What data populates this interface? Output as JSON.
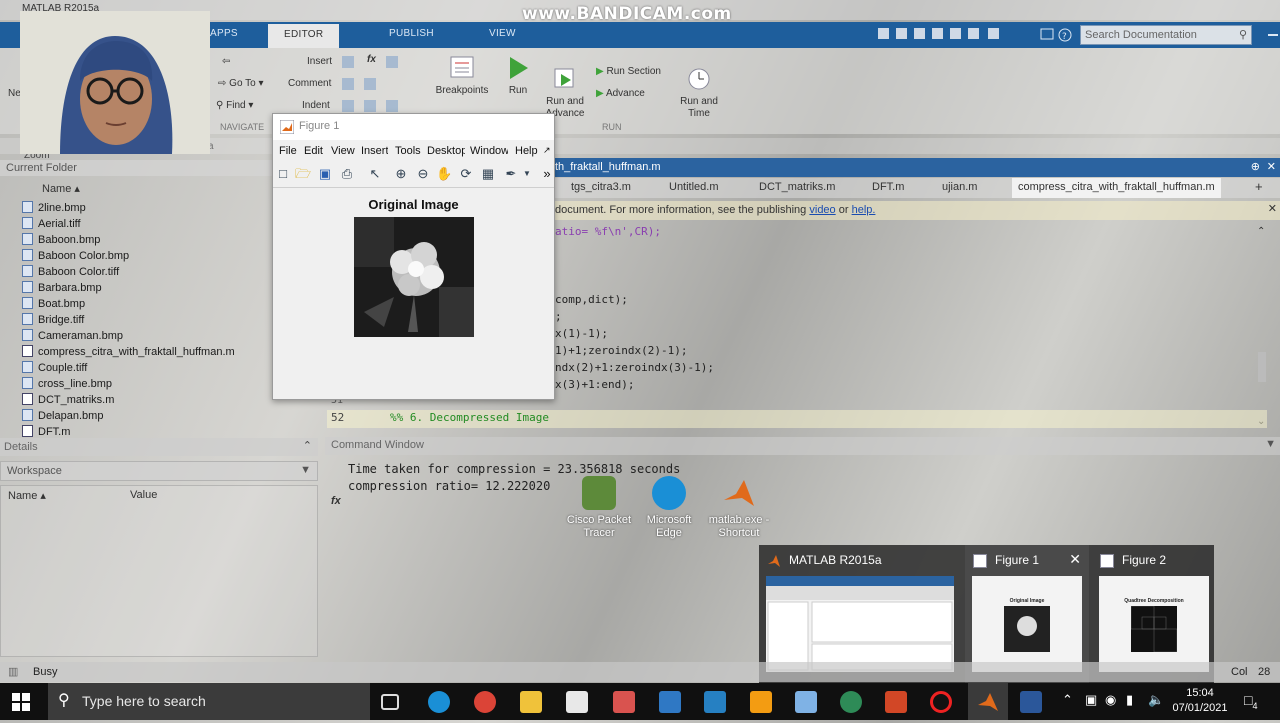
{
  "window": {
    "title": "MATLAB R2015a"
  },
  "watermark": "www.BANDICAM.com",
  "ribbon": {
    "tabs": [
      "APPS",
      "EDITOR",
      "PUBLISH",
      "VIEW"
    ],
    "search_placeholder": "Search Documentation",
    "goto_label": "Go To ▾",
    "find_label": "Find ▾",
    "insert_label": "Insert",
    "comment_label": "Comment",
    "indent_label": "Indent",
    "fx_label": "fx",
    "navigate_section": "NAVIGATE",
    "run_section": "RUN",
    "breakpoints_label": "Breakpoints",
    "run_label": "Run",
    "run_advance_label": "Run and\nAdvance",
    "run_section_label": "Run Section",
    "advance_label": "Advance",
    "run_time_label": "Run and\nTime",
    "ne_fragment": "Ne",
    "a_fragment": "a",
    "zoom_label": "Zoom"
  },
  "current_folder": {
    "title": "Current Folder",
    "column": "Name ▴",
    "files": [
      "2line.bmp",
      "Aerial.tiff",
      "Baboon.bmp",
      "Baboon Color.bmp",
      "Baboon Color.tiff",
      "Barbara.bmp",
      "Boat.bmp",
      "Bridge.tiff",
      "Cameraman.bmp",
      "compress_citra_with_fraktall_huffman.m",
      "Couple.tiff",
      "cross_line.bmp",
      "DCT_matriks.m",
      "Delapan.bmp",
      "DFT.m"
    ]
  },
  "details": {
    "title": "Details"
  },
  "workspace": {
    "title": "Workspace",
    "col_name": "Name ▴",
    "col_value": "Value"
  },
  "editor": {
    "title_fragment": "th_fraktall_huffman.m",
    "tabs": [
      "tgs_citra3.m",
      "Untitled.m",
      "DCT_matriks.m",
      "DFT.m",
      "ujian.m",
      "compress_citra_with_fraktall_huffman.m",
      "+"
    ],
    "info_text": "document. For more information, see the publishing",
    "info_link1": "video",
    "info_or": "or",
    "info_link2": "help.",
    "code_lines": [
      "atio= %f\\n',CR);",
      "comp,dict);",
      ";",
      "x(1)-1);",
      "1)+1;zeroindx(2)-1);",
      "ndx(2)+1:zeroindx(3)-1);",
      "x(3)+1:end);"
    ],
    "line51_num": "51",
    "line52_num": "52",
    "line52_text": "%% 6. Decompressed Image"
  },
  "command_window": {
    "title": "Command Window",
    "lines": [
      "Time taken for compression = 23.356818 seconds",
      "compression ratio= 12.222020"
    ],
    "prompt": "fx"
  },
  "figure": {
    "title": "Figure 1",
    "menus": [
      "File",
      "Edit",
      "View",
      "Insert",
      "Tools",
      "Desktop",
      "Window",
      "Help"
    ],
    "axes_title": "Original Image",
    "toolbar_more": "»"
  },
  "desktop_icons": [
    {
      "label": "Cisco Packet\nTracer",
      "color": "#5d8a3a"
    },
    {
      "label": "Microsoft\nEdge",
      "color": "#1a8fd6"
    },
    {
      "label": "matlab.exe -\nShortcut",
      "color": "#e06a1b"
    }
  ],
  "taskbar_previews": [
    {
      "label": "MATLAB R2015a"
    },
    {
      "label": "Figure 1",
      "close": "✕"
    },
    {
      "label": "Figure 2"
    }
  ],
  "preview_text": {
    "fig1_title": "Original Image",
    "fig2_title": "Quadtree Decomposition"
  },
  "status": {
    "state": "Busy",
    "col": "Col",
    "col_value": "28"
  },
  "taskbar": {
    "search_placeholder": "Type here to search",
    "time": "15:04",
    "date": "07/01/2021",
    "notifications": "4"
  },
  "colors": {
    "ribbon_blue": "#1e5e9c",
    "editor_blue": "#2b63a0",
    "taskbar": "#101010",
    "accent_matlab": "#e06a1b"
  }
}
